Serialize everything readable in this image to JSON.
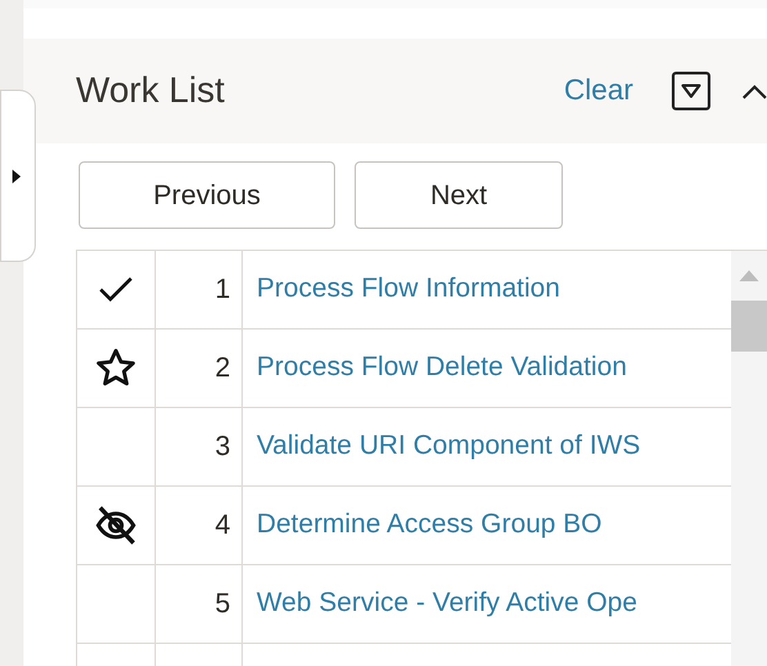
{
  "panel": {
    "title": "Work List",
    "clear_link": "Clear"
  },
  "buttons": [
    "Previous",
    "Next"
  ],
  "rows": [
    {
      "kind": "check",
      "number": "1",
      "name": "Process Flow Information"
    },
    {
      "kind": "star",
      "number": "2",
      "name": "Process Flow Delete Validation"
    },
    {
      "kind": "none",
      "number": "3",
      "name": "Validate URI Component of IWS"
    },
    {
      "kind": "hidden",
      "number": "4",
      "name": "Determine Access Group BO"
    },
    {
      "kind": "none",
      "number": "5",
      "name": "Web Service - Verify Active Ope"
    }
  ]
}
